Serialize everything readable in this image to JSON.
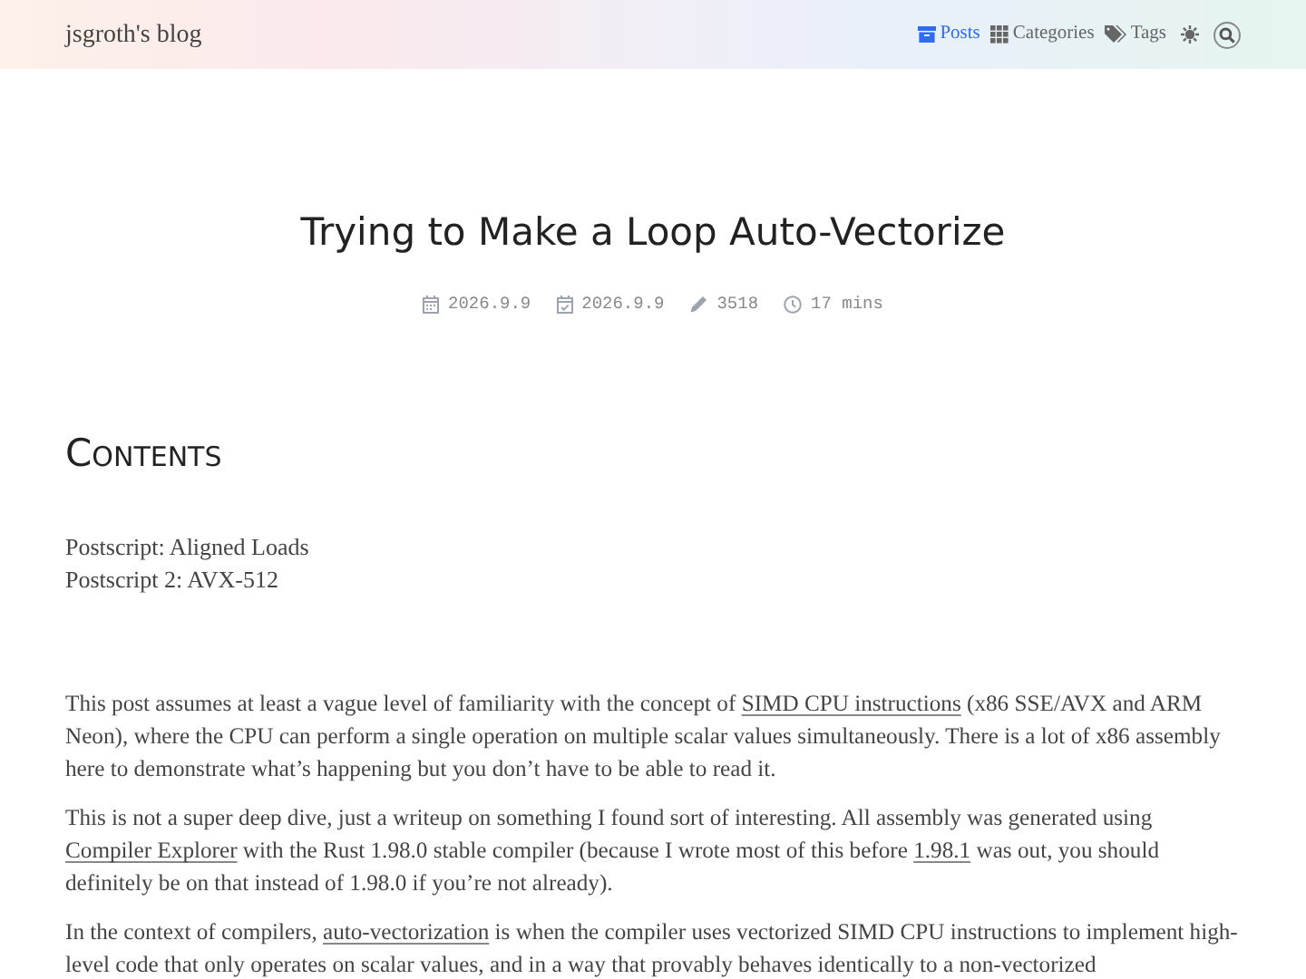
{
  "site_title": "jsgroth's blog",
  "nav": [
    {
      "label": "Posts",
      "selected": true
    },
    {
      "label": "Categories",
      "selected": false
    },
    {
      "label": "Tags",
      "selected": false
    }
  ],
  "post": {
    "title": "Trying to Make a Loop Auto-Vectorize",
    "meta": [
      {
        "kind": "created",
        "text": "2026.9.9"
      },
      {
        "kind": "updated",
        "text": "2026.9.9"
      },
      {
        "kind": "words",
        "text": "3518"
      },
      {
        "kind": "time",
        "text": "17 mins"
      }
    ],
    "contents": {
      "heading": "Contents",
      "items": [
        "Postscript: Aligned Loads",
        "Postscript 2: AVX-512"
      ]
    },
    "paragraphs": [
      [
        {
          "kind": "text",
          "text": "This post assumes at least a vague level of familiarity with the concept of "
        },
        {
          "kind": "link",
          "text": "SIMD CPU instructions"
        },
        {
          "kind": "text",
          "text": " (x86 SSE/AVX and ARM Neon), where the CPU can perform a single operation on multiple scalar values simultaneously. There is a lot of x86 assembly here to demonstrate what’s happening but you don’t have to be able to read it."
        }
      ],
      [
        {
          "kind": "text",
          "text": "This is not a super deep dive, just a writeup on something I found sort of interesting. All assembly was generated using "
        },
        {
          "kind": "link",
          "text": "Compiler Explorer"
        },
        {
          "kind": "text",
          "text": " with the Rust 1.98.0 stable compiler (because I wrote most of this before "
        },
        {
          "kind": "link",
          "text": "1.98.1"
        },
        {
          "kind": "text",
          "text": " was out, you should definitely be on that instead of 1.98.0 if you’re not already)."
        }
      ],
      [
        {
          "kind": "text",
          "text": "In the context of compilers, "
        },
        {
          "kind": "link",
          "text": "auto-vectorization"
        },
        {
          "kind": "text",
          "text": " is when the compiler uses vectorized SIMD CPU instructions to implement high-level code that only operates on scalar values, and in a way that provably behaves identically to a non-vectorized"
        }
      ]
    ]
  }
}
